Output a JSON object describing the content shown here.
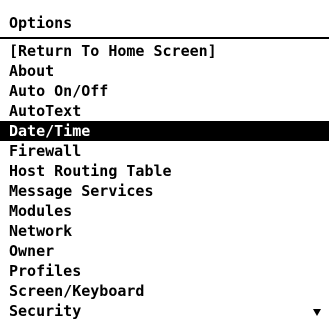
{
  "screen": {
    "title": "Options",
    "selected_index": 4,
    "menu_items": [
      {
        "label": "[Return To Home Screen]"
      },
      {
        "label": "About"
      },
      {
        "label": "Auto On/Off"
      },
      {
        "label": "AutoText"
      },
      {
        "label": "Date/Time"
      },
      {
        "label": "Firewall"
      },
      {
        "label": "Host Routing Table"
      },
      {
        "label": "Message Services"
      },
      {
        "label": "Modules"
      },
      {
        "label": "Network"
      },
      {
        "label": "Owner"
      },
      {
        "label": "Profiles"
      },
      {
        "label": "Screen/Keyboard"
      },
      {
        "label": "Security"
      }
    ],
    "scroll_indicator_icon": "arrow-down-icon"
  },
  "colors": {
    "background": "#ffffff",
    "text": "#000000",
    "selection_background": "#000000",
    "selection_text": "#ffffff"
  }
}
